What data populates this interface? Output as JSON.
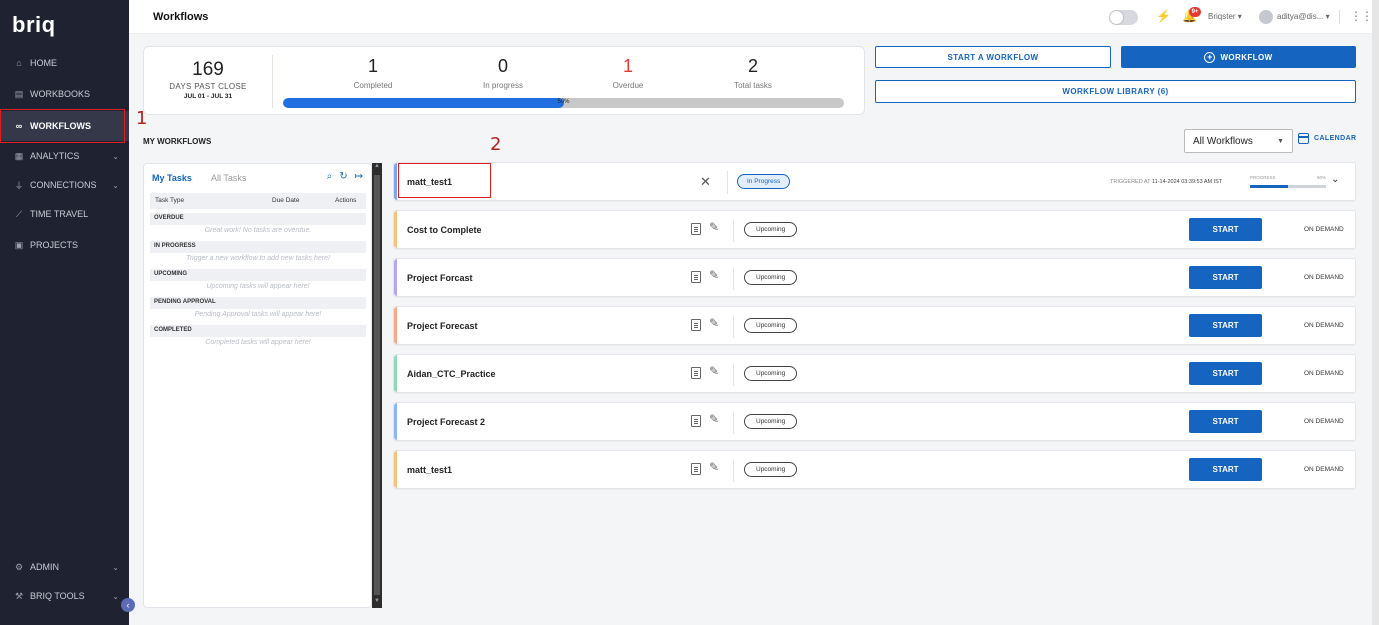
{
  "sidebar": {
    "logo": "briq",
    "items": [
      {
        "label": "HOME",
        "icon": "home-icon"
      },
      {
        "label": "WORKBOOKS",
        "icon": "workbook-icon"
      },
      {
        "label": "WORKFLOWS",
        "icon": "workflow-icon"
      },
      {
        "label": "ANALYTICS",
        "icon": "analytics-icon"
      },
      {
        "label": "CONNECTIONS",
        "icon": "connections-icon"
      },
      {
        "label": "TIME TRAVEL",
        "icon": "time-travel-icon"
      },
      {
        "label": "PROJECTS",
        "icon": "projects-icon"
      }
    ],
    "bottom_items": [
      {
        "label": "ADMIN",
        "icon": "gear-icon"
      },
      {
        "label": "BRIQ TOOLS",
        "icon": "tools-icon"
      }
    ]
  },
  "annotations": {
    "marker1": "1",
    "marker2": "2"
  },
  "header": {
    "title": "Workflows",
    "notification_count": "9+",
    "org": "Briqster",
    "user": "aditya@dis..."
  },
  "stats": {
    "days": "169",
    "days_label": "DAYS PAST CLOSE",
    "date_range": "JUL 01 - JUL 31",
    "completed": "1",
    "completed_label": "Completed",
    "in_progress": "0",
    "in_progress_label": "In progress",
    "overdue": "1",
    "overdue_label": "Overdue",
    "total": "2",
    "total_label": "Total tasks",
    "progress_text": "50%",
    "progress_value": 50
  },
  "actions": {
    "start_workflow": "START A WORKFLOW",
    "new_workflow": "WORKFLOW",
    "library": "WORKFLOW LIBRARY (6)"
  },
  "main": {
    "section_title": "MY WORKFLOWS",
    "filter": "All Workflows",
    "calendar": "CALENDAR"
  },
  "tasks": {
    "tab_my": "My Tasks",
    "tab_all": "All Tasks",
    "col_type": "Task Type",
    "col_due": "Due Date",
    "col_actions": "Actions",
    "sections": [
      {
        "title": "OVERDUE",
        "empty": "Great work! No tasks are overdue."
      },
      {
        "title": "IN PROGRESS",
        "empty": "Trigger a new workflow to add new tasks here!"
      },
      {
        "title": "UPCOMING",
        "empty": "Upcoming tasks will appear here!"
      },
      {
        "title": "PENDING APPROVAL",
        "empty": "Pending Approval tasks will appear here!"
      },
      {
        "title": "COMPLETED",
        "empty": "Completed tasks will appear here!"
      }
    ]
  },
  "workflows": {
    "active": {
      "name": "matt_test1",
      "status": "In Progress",
      "triggered_label": "TRIGGERED AT",
      "triggered_at": "11-14-2024 03:39:53 AM IST",
      "progress_label": "PROGRESS",
      "progress_pct": "50%",
      "progress_value": 50,
      "accent": "#7aa7f0"
    },
    "list": [
      {
        "name": "Cost to Complete",
        "status": "Upcoming",
        "button": "START",
        "frequency": "ON DEMAND",
        "accent": "#f3c37a"
      },
      {
        "name": "Project Forcast",
        "status": "Upcoming",
        "button": "START",
        "frequency": "ON DEMAND",
        "accent": "#b7a6f0"
      },
      {
        "name": "Project Forecast",
        "status": "Upcoming",
        "button": "START",
        "frequency": "ON DEMAND",
        "accent": "#f7a98a"
      },
      {
        "name": "Aidan_CTC_Practice",
        "status": "Upcoming",
        "button": "START",
        "frequency": "ON DEMAND",
        "accent": "#8fd9b6"
      },
      {
        "name": "Project Forecast 2",
        "status": "Upcoming",
        "button": "START",
        "frequency": "ON DEMAND",
        "accent": "#8db6f5"
      },
      {
        "name": "matt_test1",
        "status": "Upcoming",
        "button": "START",
        "frequency": "ON DEMAND",
        "accent": "#f3c37a"
      }
    ]
  }
}
